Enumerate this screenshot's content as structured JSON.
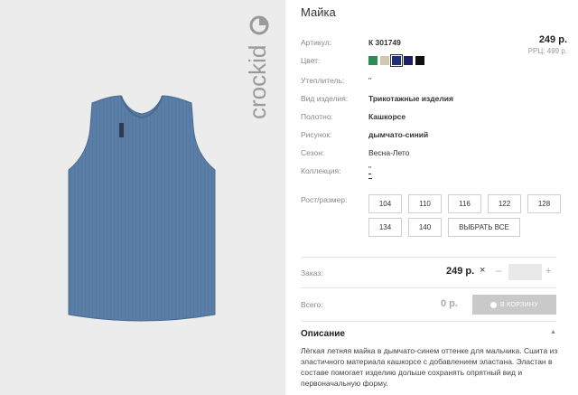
{
  "brand": {
    "logo_text": "crockid"
  },
  "product": {
    "title": "Майка",
    "price": "249 р.",
    "rrp": "РРЦ: 499 р."
  },
  "specs": {
    "article_label": "Артикул:",
    "article_value": "К 301749",
    "color_label": "Цвет:",
    "colors": [
      {
        "name": "green",
        "hex": "#2e8b57"
      },
      {
        "name": "beige",
        "hex": "#d2c9ad"
      },
      {
        "name": "navy-selected",
        "hex": "#1f2f7a"
      },
      {
        "name": "navy",
        "hex": "#1a1f66"
      },
      {
        "name": "black",
        "hex": "#111111"
      }
    ],
    "insulation_label": "Утеплитель:",
    "insulation_value": "\"",
    "type_label": "Вид изделия:",
    "type_value": "Трикотажные изделия",
    "fabric_label": "Полотно:",
    "fabric_value": "Кашкорсе",
    "pattern_label": "Рисунок:",
    "pattern_value": "дымчато-синий",
    "season_label": "Сезон:",
    "season_value": "Весна-Лето",
    "collection_label": "Коллекция:",
    "collection_value": "\""
  },
  "sizes": {
    "label": "Рост/размер:",
    "options": [
      "104",
      "110",
      "116",
      "122",
      "128",
      "134",
      "140"
    ],
    "select_all": "ВЫБРАТЬ ВСЕ"
  },
  "order": {
    "label": "Заказ:",
    "price": "249 р.",
    "times": "×",
    "minus": "–",
    "plus": "+",
    "quantity": ""
  },
  "total": {
    "label": "Всего:",
    "price": "0 р.",
    "cart_button": "В КОРЗИНУ"
  },
  "description": {
    "title": "Описание",
    "text": "Лёгкая летняя майка в дымчато-синем оттенке для мальчика. Сшита из эластичного материала кашкорсе с добавлением эластана. Эластан в составе помогает изделию дольше сохранять опрятный вид и первоначальную форму."
  }
}
